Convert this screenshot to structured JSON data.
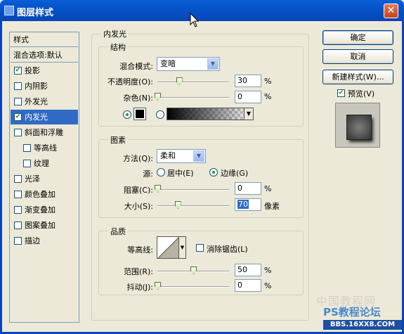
{
  "window": {
    "title": "图层样式",
    "close_symbol": "✕"
  },
  "sidebar": {
    "header": "样式",
    "blend_default": "混合选项:默认",
    "items": [
      {
        "label": "投影",
        "checked": true
      },
      {
        "label": "内阴影",
        "checked": false
      },
      {
        "label": "外发光",
        "checked": false
      },
      {
        "label": "内发光",
        "checked": true,
        "selected": true
      },
      {
        "label": "斜面和浮雕",
        "checked": false
      },
      {
        "label": "等高线",
        "checked": false,
        "indent": true
      },
      {
        "label": "纹理",
        "checked": false,
        "indent": true
      },
      {
        "label": "光泽",
        "checked": false
      },
      {
        "label": "颜色叠加",
        "checked": false
      },
      {
        "label": "渐变叠加",
        "checked": false
      },
      {
        "label": "图案叠加",
        "checked": false
      },
      {
        "label": "描边",
        "checked": false
      }
    ]
  },
  "panel": {
    "title": "内发光",
    "structure": {
      "title": "结构",
      "blend_mode_label": "混合模式:",
      "blend_mode_value": "变暗",
      "opacity_label": "不透明度(O):",
      "opacity_value": "30",
      "opacity_level": 0.3,
      "noise_label": "杂色(N):",
      "noise_value": "0",
      "noise_level": 0,
      "unit": "%",
      "color_mode": "solid",
      "solid_color": "#000000"
    },
    "elements": {
      "title": "图素",
      "method_label": "方法(Q):",
      "method_value": "柔和",
      "source_label": "源:",
      "source_center": "居中(E)",
      "source_edge": "边缘(G)",
      "source_selected": "edge",
      "choke_label": "阻塞(C):",
      "choke_value": "0",
      "choke_level": 0,
      "size_label": "大小(S):",
      "size_value": "70",
      "size_level": 0.28,
      "size_unit": "像素",
      "unit": "%"
    },
    "quality": {
      "title": "品质",
      "contour_label": "等高线:",
      "antialias_label": "消除锯齿(L)",
      "antialias_checked": false,
      "range_label": "范围(R):",
      "range_value": "50",
      "range_level": 0.5,
      "jitter_label": "抖动(J):",
      "jitter_value": "0",
      "jitter_level": 0,
      "unit": "%"
    }
  },
  "buttons": {
    "ok": "确定",
    "cancel": "取消",
    "new_style": "新建样式(W)...",
    "preview_label": "预览(V)",
    "preview_checked": true
  },
  "watermark": {
    "site": "PS教程论坛",
    "url": "BBS.16XX8.COM",
    "cn": "中国教程网"
  }
}
